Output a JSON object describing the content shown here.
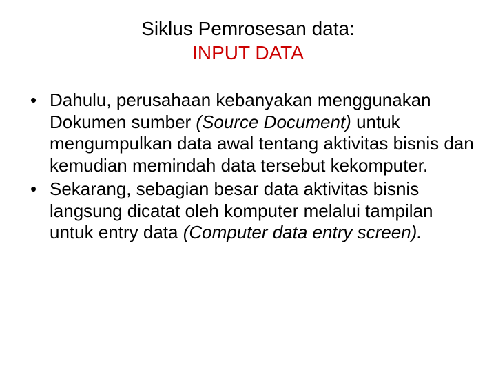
{
  "title": {
    "line1": "Siklus Pemrosesan data:",
    "line2": "INPUT DATA"
  },
  "bullets": [
    {
      "pre": "Dahulu, perusahaan kebanyakan menggunakan Dokumen sumber ",
      "italic": "(Source Document)",
      "post": " untuk mengumpulkan data awal tentang aktivitas bisnis dan kemudian memindah data tersebut kekomputer."
    },
    {
      "pre": "Sekarang, sebagian besar data aktivitas bisnis langsung dicatat oleh komputer melalui tampilan untuk entry data ",
      "italic": "(Computer data entry screen).",
      "post": ""
    }
  ]
}
